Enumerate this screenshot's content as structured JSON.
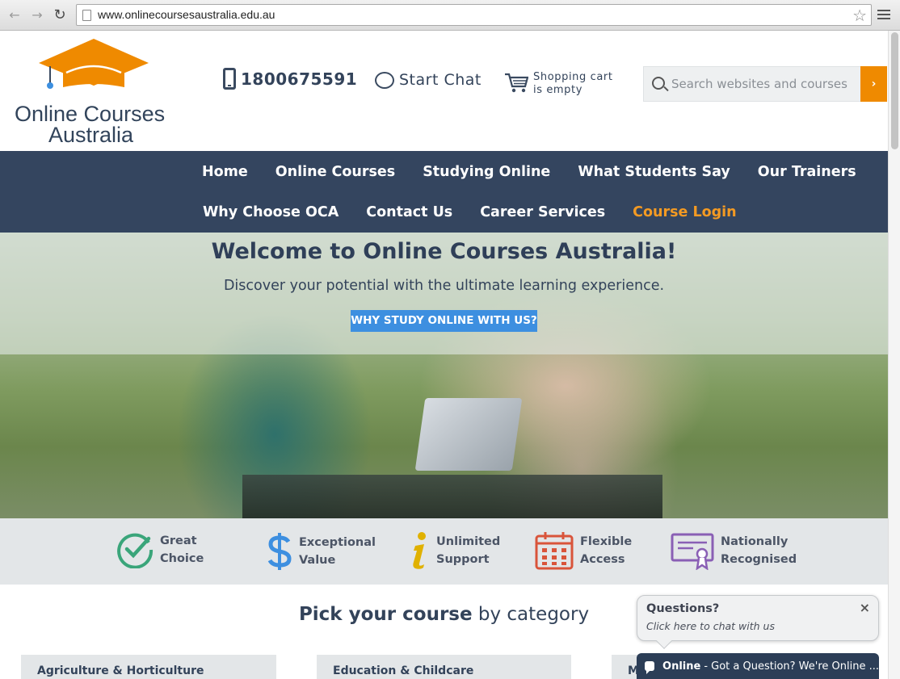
{
  "browser": {
    "url": "www.onlinecoursesaustralia.edu.au"
  },
  "header": {
    "logo_line1": "Online Courses",
    "logo_line2": "Australia",
    "phone": "1800675591",
    "chat_label": "Start Chat",
    "cart_line1": "Shopping cart",
    "cart_line2": "is empty",
    "search_placeholder": "Search websites and courses",
    "search_go": "›"
  },
  "nav": {
    "items": [
      "Home",
      "Online Courses",
      "Studying Online",
      "What Students Say",
      "Our Trainers",
      "Why Choose OCA",
      "Contact Us",
      "Career Services",
      "Course Login"
    ]
  },
  "hero": {
    "title": "Welcome to Online Courses Australia!",
    "subtitle": "Discover your potential with the ultimate learning experience.",
    "cta": "WHY STUDY ONLINE WITH US?"
  },
  "features": [
    {
      "line1": "Great",
      "line2": "Choice",
      "icon": "check-circle-icon",
      "color": "#3aa57a"
    },
    {
      "line1": "Exceptional",
      "line2": "Value",
      "icon": "dollar-icon",
      "color": "#3d8fe0"
    },
    {
      "line1": "Unlimited",
      "line2": "Support",
      "icon": "info-icon",
      "color": "#e0b100"
    },
    {
      "line1": "Flexible",
      "line2": "Access",
      "icon": "calendar-icon",
      "color": "#d9543a"
    },
    {
      "line1": "Nationally",
      "line2": "Recognised",
      "icon": "certificate-icon",
      "color": "#8a5fb5"
    }
  ],
  "pick": {
    "bold": "Pick your course",
    "rest": " by category"
  },
  "categories": [
    "Agriculture & Horticulture",
    "Education & Childcare",
    "M"
  ],
  "chat_widget": {
    "title": "Questions?",
    "subtitle": "Click here to chat with us",
    "close": "×",
    "status": "Online",
    "message": "- Got a Question? We're Online ..."
  },
  "colors": {
    "brand_navy": "#34455f",
    "accent_orange": "#ef8a00",
    "cta_blue": "#3d8fe0"
  }
}
